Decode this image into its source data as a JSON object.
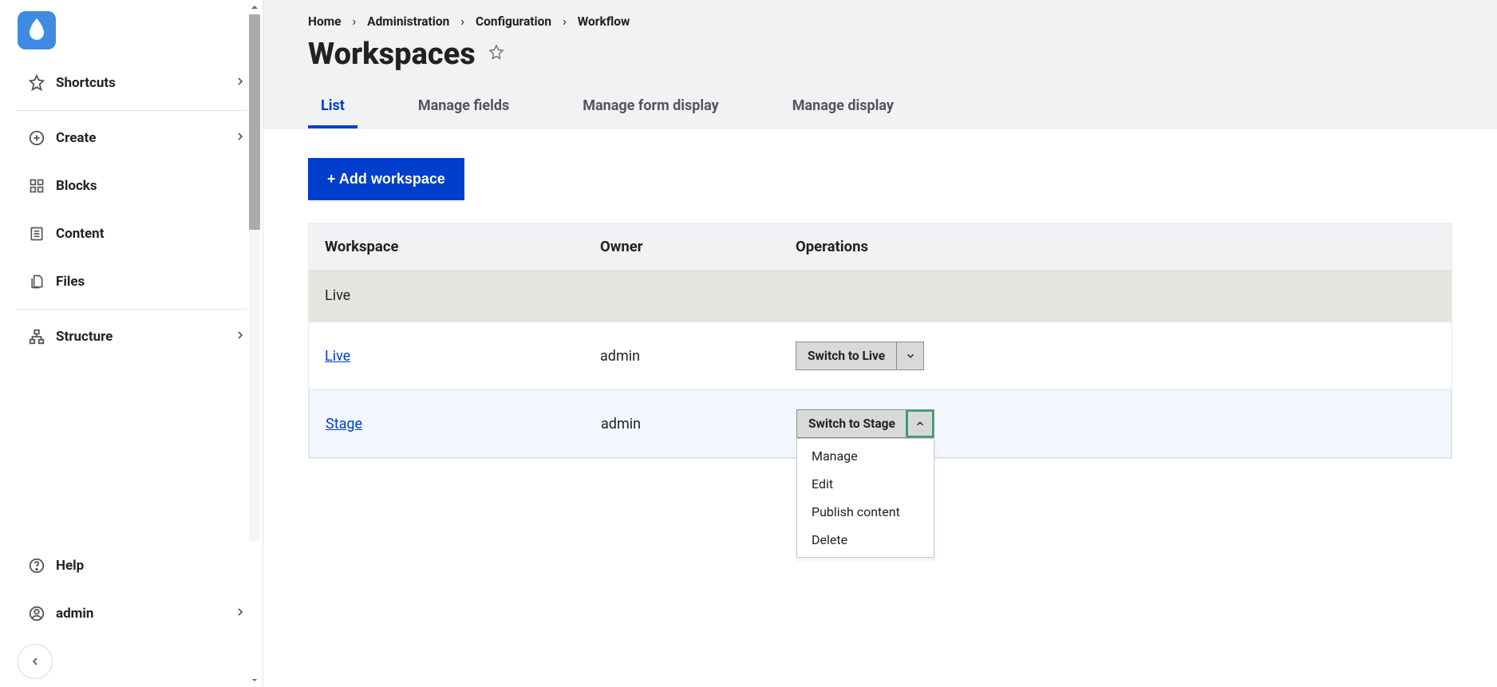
{
  "sidebar": {
    "items": [
      {
        "label": "Shortcuts"
      },
      {
        "label": "Create"
      },
      {
        "label": "Blocks"
      },
      {
        "label": "Content"
      },
      {
        "label": "Files"
      },
      {
        "label": "Structure"
      },
      {
        "label": "Help"
      },
      {
        "label": "admin"
      }
    ]
  },
  "breadcrumb": {
    "items": [
      "Home",
      "Administration",
      "Configuration",
      "Workflow"
    ]
  },
  "page": {
    "title": "Workspaces"
  },
  "tabs": {
    "items": [
      {
        "label": "List",
        "active": true
      },
      {
        "label": "Manage fields"
      },
      {
        "label": "Manage form display"
      },
      {
        "label": "Manage display"
      }
    ]
  },
  "actions": {
    "add_workspace": "+ Add workspace"
  },
  "table": {
    "headers": {
      "workspace": "Workspace",
      "owner": "Owner",
      "operations": "Operations"
    },
    "group_row": "Live",
    "rows": [
      {
        "name": "Live",
        "owner": "admin",
        "op_label": "Switch to Live",
        "open": false
      },
      {
        "name": "Stage",
        "owner": "admin",
        "op_label": "Switch to Stage",
        "open": true
      }
    ]
  },
  "dropdown": {
    "items": [
      "Manage",
      "Edit",
      "Publish content",
      "Delete"
    ]
  }
}
